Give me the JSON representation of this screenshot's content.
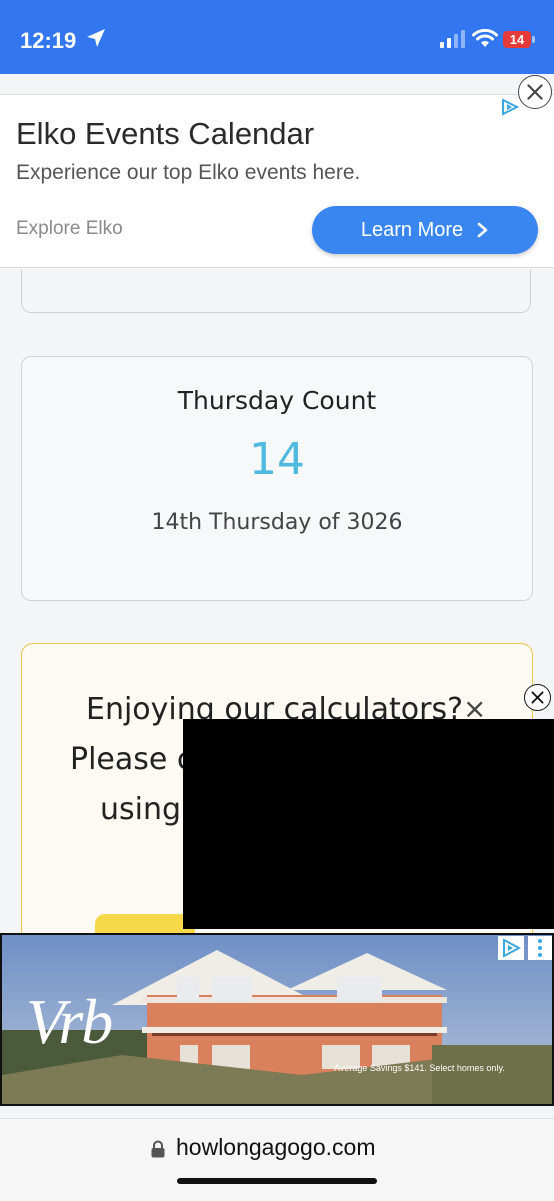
{
  "status_bar": {
    "time": "12:19",
    "battery": "14"
  },
  "top_ad": {
    "title": "Elko Events Calendar",
    "subtitle": "Experience our top Elko events here.",
    "brand": "Explore Elko",
    "button_label": "Learn More",
    "button_color": "#3a86f0"
  },
  "result_card": {
    "title": "Thursday Count",
    "value": "14",
    "description": "14th Thursday of 3026",
    "value_color": "#4fb9df"
  },
  "promo_card": {
    "line1": "Enjoying our calculators?",
    "line2": "Please c",
    "line3": "using",
    "close_glyph": "×",
    "accent_color": "#f0c64a"
  },
  "bottom_ad": {
    "logo_text": "Vrb",
    "disclaimer": "Average Savings $141. Select homes only."
  },
  "browser": {
    "url": "howlongagogo.com"
  },
  "icons": [
    "location-arrow-icon",
    "cellular-signal-icon",
    "wifi-icon",
    "battery-icon",
    "ad-choices-icon",
    "close-icon",
    "chevron-right-icon",
    "more-options-icon",
    "lock-icon"
  ]
}
